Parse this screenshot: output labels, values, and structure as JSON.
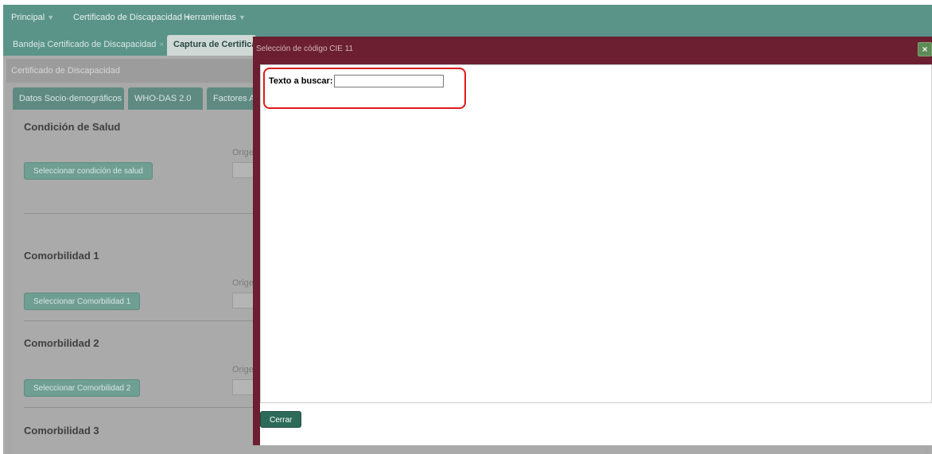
{
  "menubar": {
    "items": [
      {
        "label": "Principal"
      },
      {
        "label": "Certificado de Discapacidad"
      },
      {
        "label": "Herramientas"
      }
    ]
  },
  "tabs": [
    {
      "label": "Bandeja Certificado de Discapacidad",
      "close": "×"
    },
    {
      "label": "Captura de Certifica"
    }
  ],
  "panel": {
    "header": "Certificado de Discapacidad",
    "subtabs": [
      "Datos Socio-demográficos",
      "WHO-DAS 2.0",
      "Factores Am"
    ],
    "sections": [
      {
        "title": "Condición de Salud",
        "button": "Seleccionar condición de salud",
        "origin_label": "Origen"
      },
      {
        "title": "Comorbilidad 1",
        "button": "Seleccionar Comorbilidad 1",
        "origin_label": "Origen"
      },
      {
        "title": "Comorbilidad 2",
        "button": "Seleccionar Comorbilidad 2",
        "origin_label": "Origen"
      },
      {
        "title": "Comorbilidad 3"
      }
    ]
  },
  "dialog": {
    "title": "Selección de código CIE 11",
    "close_icon": "×",
    "search": {
      "label": "Texto a buscar:",
      "value": ""
    },
    "close_button": "Cerrar"
  },
  "colors": {
    "menubar": "#5a9488",
    "dialog_frame": "#6b1f30",
    "primary_button": "#2d6b58",
    "highlight": "#e01b1b"
  }
}
